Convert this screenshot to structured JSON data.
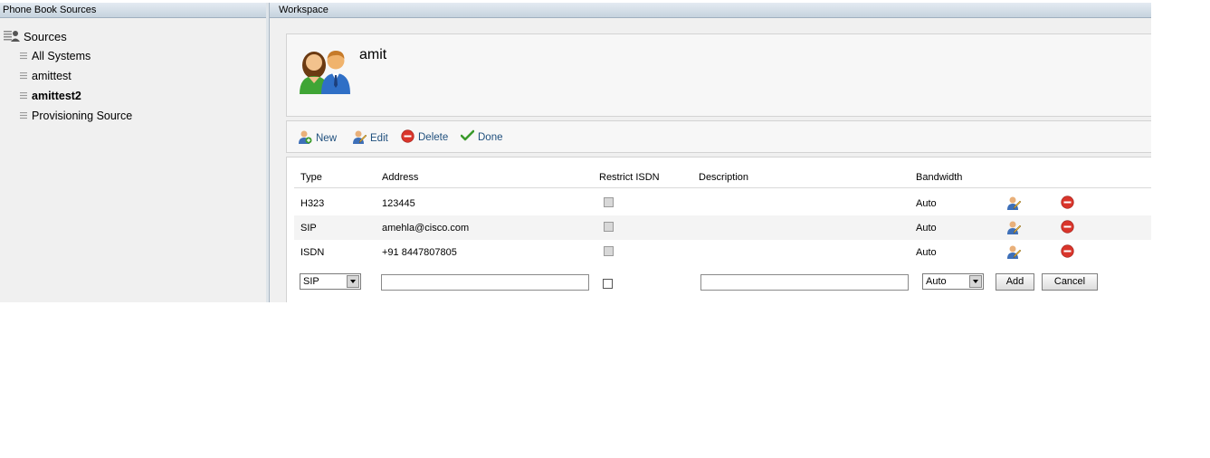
{
  "left_panel": {
    "title": "Phone Book Sources",
    "root_label": "Sources",
    "items": [
      {
        "label": "All Systems"
      },
      {
        "label": "amittest"
      },
      {
        "label": "amittest2"
      },
      {
        "label": "Provisioning Source"
      }
    ]
  },
  "workspace": {
    "title": "Workspace",
    "contact_name": "amit",
    "toolbar": {
      "new_label": "New",
      "edit_label": "Edit",
      "delete_label": "Delete",
      "done_label": "Done"
    },
    "table": {
      "headers": [
        "Type",
        "Address",
        "Restrict ISDN",
        "Description",
        "Bandwidth"
      ],
      "rows": [
        {
          "type": "H323",
          "address": "123445",
          "description": "",
          "bandwidth": "Auto"
        },
        {
          "type": "SIP",
          "address": "amehla@cisco.com",
          "description": "",
          "bandwidth": "Auto"
        },
        {
          "type": "ISDN",
          "address": "+91 8447807805",
          "description": "",
          "bandwidth": "Auto"
        }
      ]
    },
    "new_entry": {
      "type_value": "SIP",
      "bandwidth_value": "Auto",
      "add_label": "Add",
      "cancel_label": "Cancel"
    }
  },
  "colors": {
    "header_gradient_top": "#e4ebf2",
    "header_gradient_bottom": "#c6d3de",
    "link_blue": "#1f4f7d",
    "delete_red": "#d9352b",
    "done_green": "#3a9a2b"
  }
}
